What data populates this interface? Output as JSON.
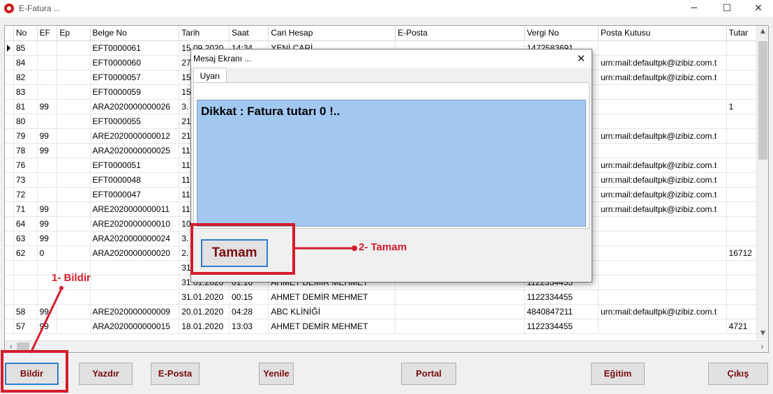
{
  "window": {
    "title": "E-Fatura ...",
    "minimize": "─",
    "maximize": "☐",
    "close": "✕"
  },
  "grid": {
    "columns": [
      "",
      "No",
      "EF",
      "Ep",
      "Belge No",
      "Tarih",
      "Saat",
      "Cari Hesap",
      "E-Posta",
      "Vergi No",
      "Posta Kutusu",
      "Tutar"
    ],
    "rows": [
      [
        "85",
        "",
        "",
        "EFT0000061",
        "15.09.2020",
        "14:34",
        "YENİ CARİ",
        "",
        "1472583691",
        "",
        ""
      ],
      [
        "84",
        "",
        "",
        "EFT0000060",
        "27",
        "",
        "",
        "",
        "",
        "urn:mail:defaultpk@izibiz.com.t",
        ""
      ],
      [
        "82",
        "",
        "",
        "EFT0000057",
        "15",
        "",
        "",
        "",
        "",
        "urn:mail:defaultpk@izibiz.com.t",
        ""
      ],
      [
        "83",
        "",
        "",
        "EFT0000059",
        "15",
        "",
        "",
        "",
        "",
        "",
        ""
      ],
      [
        "81",
        "99",
        "",
        "ARA2020000000026",
        "3.",
        "",
        "",
        "",
        "",
        "",
        "1"
      ],
      [
        "80",
        "",
        "",
        "EFT0000055",
        "21",
        "",
        "",
        "",
        "",
        "",
        ""
      ],
      [
        "79",
        "99",
        "",
        "ARE2020000000012",
        "21",
        "",
        "",
        "",
        "",
        "urn:mail:defaultpk@izibiz.com.t",
        ""
      ],
      [
        "78",
        "99",
        "",
        "ARA2020000000025",
        "11",
        "",
        "",
        "",
        "",
        "",
        ""
      ],
      [
        "76",
        "",
        "",
        "EFT0000051",
        "11",
        "",
        "",
        "",
        "",
        "urn:mail:defaultpk@izibiz.com.t",
        ""
      ],
      [
        "73",
        "",
        "",
        "EFT0000048",
        "11",
        "",
        "",
        "",
        "",
        "urn:mail:defaultpk@izibiz.com.t",
        ""
      ],
      [
        "72",
        "",
        "",
        "EFT0000047",
        "11",
        "",
        "",
        "",
        "",
        "urn:mail:defaultpk@izibiz.com.t",
        ""
      ],
      [
        "71",
        "99",
        "",
        "ARE2020000000011",
        "11",
        "",
        "",
        "",
        "",
        "urn:mail:defaultpk@izibiz.com.t",
        ""
      ],
      [
        "64",
        "99",
        "",
        "ARE2020000000010",
        "10",
        "",
        "",
        "",
        "",
        "",
        ""
      ],
      [
        "63",
        "99",
        "",
        "ARA2020000000024",
        "3.",
        "",
        "",
        "",
        "",
        "",
        ""
      ],
      [
        "62",
        "0",
        "",
        "ARA2020000000020",
        "2.",
        "",
        "",
        "",
        "",
        "",
        "16712"
      ],
      [
        "",
        "",
        "",
        "",
        "31",
        "",
        "",
        "",
        "",
        "",
        ""
      ],
      [
        "",
        "",
        "",
        "",
        "31.01.2020",
        "01:16",
        "AHMET DEMİR MEHMET",
        "",
        "1122334455",
        "",
        ""
      ],
      [
        "",
        "",
        "",
        "",
        "31.01.2020",
        "00:15",
        "AHMET DEMİR MEHMET",
        "",
        "1122334455",
        "",
        ""
      ],
      [
        "58",
        "99",
        "",
        "ARE2020000000009",
        "20.01.2020",
        "04:28",
        "ABC KLİNİĞİ",
        "",
        "4840847211",
        "urn:mail:defaultpk@izibiz.com.t",
        ""
      ],
      [
        "57",
        "99",
        "",
        "ARA2020000000015",
        "18.01.2020",
        "13:03",
        "AHMET DEMİR MEHMET",
        "",
        "1122334455",
        "",
        "4721"
      ]
    ],
    "selected_row": 0
  },
  "buttons": {
    "bildir": "Bildir",
    "yazdir": "Yazdır",
    "eposta": "E-Posta",
    "yenile": "Yenile",
    "portal": "Portal",
    "egitim": "Eğitim",
    "cikis": "Çıkış"
  },
  "dialog": {
    "title": "Mesaj Ekranı ...",
    "close": "✕",
    "tab": "Uyarı",
    "message": "Dikkat : Fatura tutarı 0 !..",
    "ok": "Tamam"
  },
  "annotations": {
    "step1": "1- Bildir",
    "step2": "2- Tamam",
    "color": "#d41c2c"
  }
}
